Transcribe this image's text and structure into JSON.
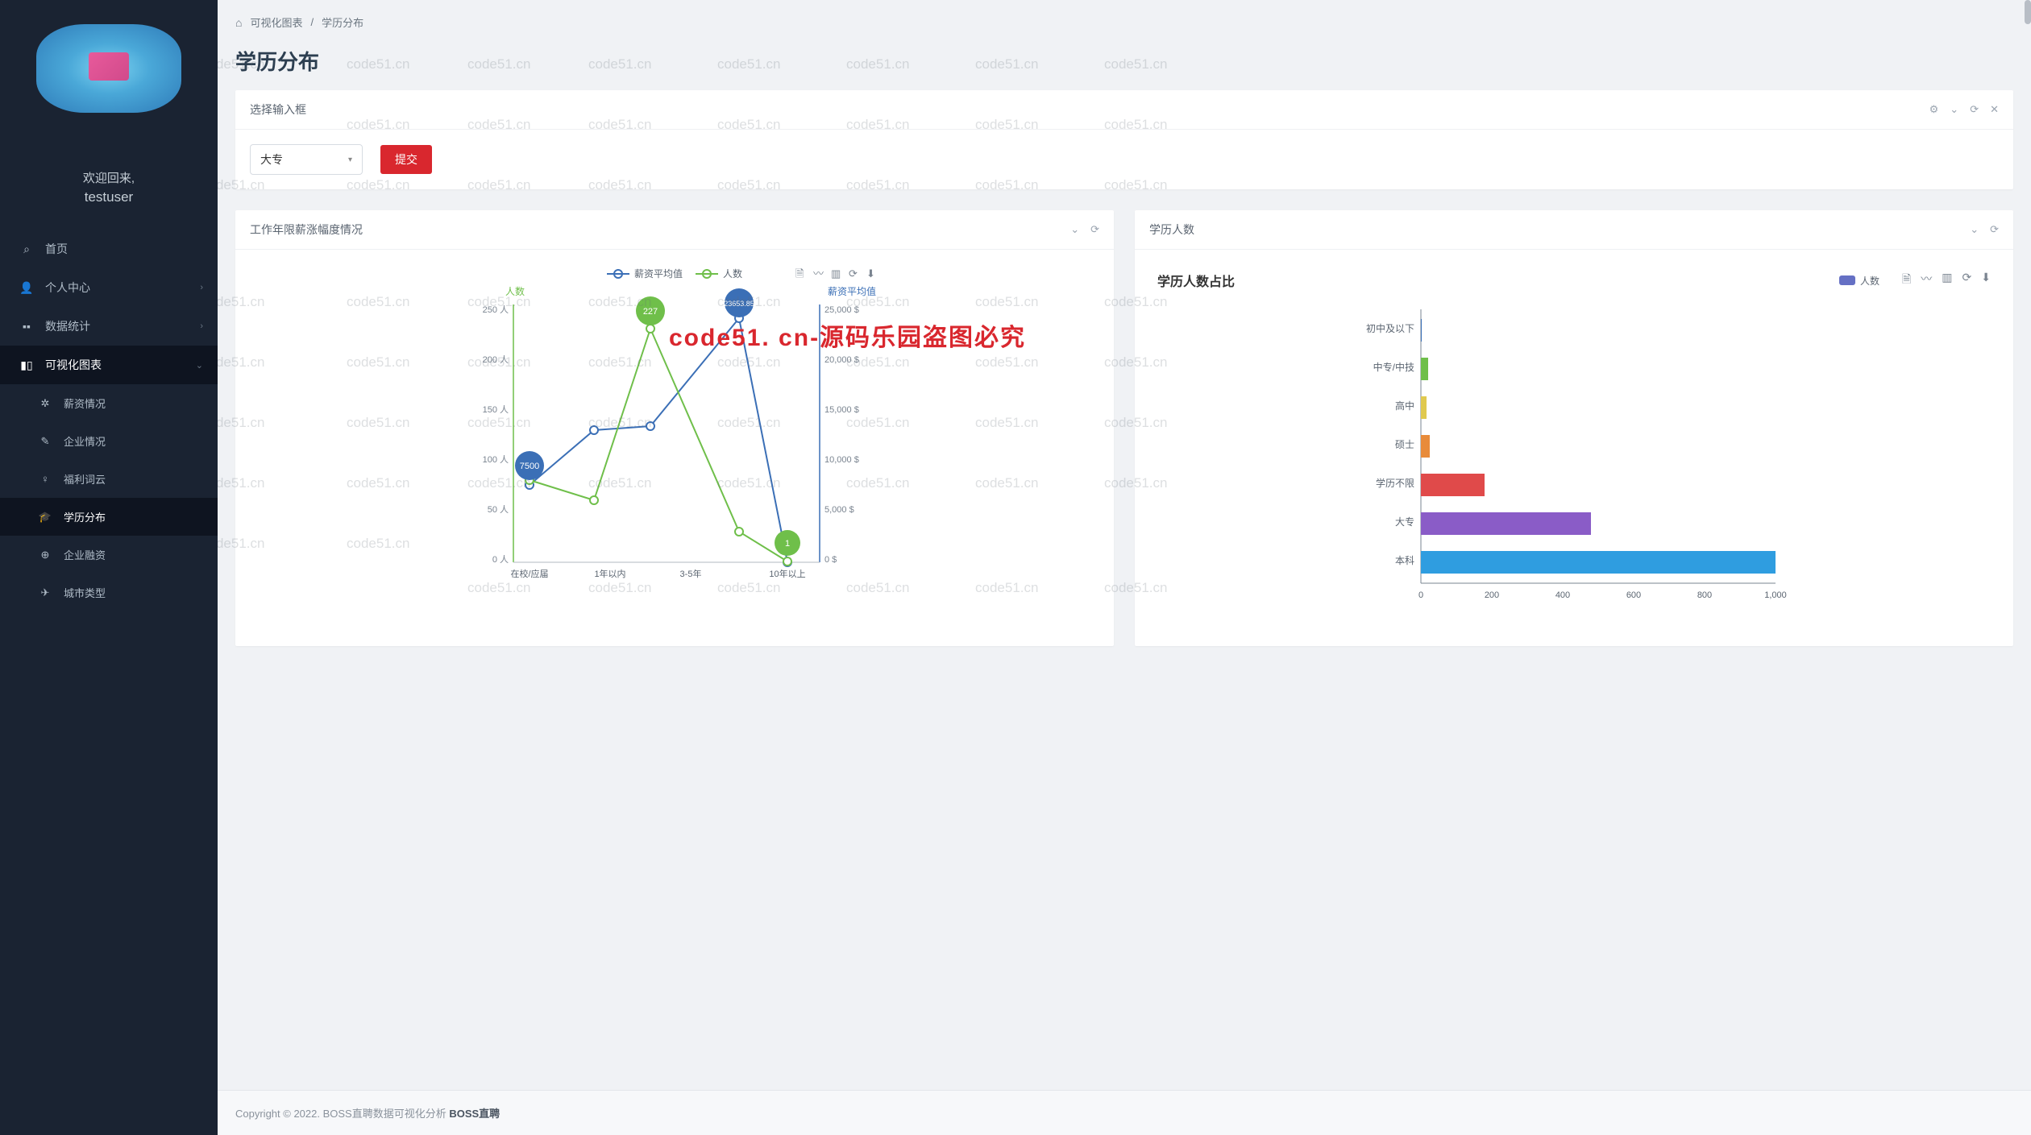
{
  "sidebar": {
    "welcome_line1": "欢迎回来,",
    "welcome_line2": "testuser",
    "items": [
      {
        "label": "首页"
      },
      {
        "label": "个人中心"
      },
      {
        "label": "数据统计"
      },
      {
        "label": "可视化图表"
      },
      {
        "label": "薪资情况"
      },
      {
        "label": "企业情况"
      },
      {
        "label": "福利词云"
      },
      {
        "label": "学历分布"
      },
      {
        "label": "企业融资"
      },
      {
        "label": "城市类型"
      }
    ]
  },
  "breadcrumb": {
    "item1": "可视化图表",
    "sep": "/",
    "item2": "学历分布"
  },
  "page_title": "学历分布",
  "filter_panel": {
    "title": "选择输入框",
    "select_value": "大专",
    "submit_label": "提交"
  },
  "panel1": {
    "title": "工作年限薪涨幅度情况"
  },
  "panel2": {
    "title": "学历人数",
    "chart_title": "学历人数占比",
    "legend": "人数"
  },
  "legend_chart1": {
    "s1": "薪资平均值",
    "s2": "人数"
  },
  "y1label": "人数",
  "y2label": "薪资平均值",
  "balloon1": "7500",
  "balloon2": "227",
  "balloon3": "23653.85",
  "balloon4": "1",
  "footer": {
    "text": "Copyright © 2022. BOSS直聘数据可视化分析 ",
    "bold": "BOSS直聘"
  },
  "watermark": "code51.cn",
  "red_watermark": "code51. cn-源码乐园盗图必究",
  "chart_data": [
    {
      "type": "line",
      "title": "工作年限薪涨幅度情况",
      "x_categories": [
        "在校/应届",
        "1年以内",
        "3-5年",
        "10年以上"
      ],
      "y_left": {
        "label": "人数",
        "min": 0,
        "max": 250,
        "step": 50,
        "unit": "人"
      },
      "y_right": {
        "label": "薪资平均值",
        "min": 0,
        "max": 25000,
        "step": 5000,
        "unit": "$"
      },
      "series": [
        {
          "name": "薪资平均值",
          "axis": "right",
          "color": "#3b6fb6",
          "values": [
            7500,
            12800,
            13200,
            23653.85,
            0
          ]
        },
        {
          "name": "人数",
          "axis": "left",
          "color": "#6fbf4a",
          "values": [
            80,
            60,
            227,
            30,
            1
          ]
        }
      ],
      "annotations": [
        {
          "series": "薪资平均值",
          "index": 0,
          "value": 7500
        },
        {
          "series": "人数",
          "index": 2,
          "value": 227
        },
        {
          "series": "薪资平均值",
          "index": 3,
          "value": 23653.85
        },
        {
          "series": "人数",
          "index": 4,
          "value": 1
        }
      ]
    },
    {
      "type": "bar",
      "orientation": "horizontal",
      "title": "学历人数占比",
      "x": {
        "min": 0,
        "max": 1000,
        "step": 200
      },
      "categories": [
        "初中及以下",
        "中专/中技",
        "高中",
        "硕士",
        "学历不限",
        "大专",
        "本科"
      ],
      "series": [
        {
          "name": "人数",
          "colors": [
            "#3b6fb6",
            "#6fbf4a",
            "#e0c94f",
            "#e88b3a",
            "#e04a4a",
            "#8a5cc7",
            "#2f9de0"
          ],
          "values": [
            2,
            20,
            15,
            25,
            180,
            480,
            1000
          ]
        }
      ]
    }
  ]
}
